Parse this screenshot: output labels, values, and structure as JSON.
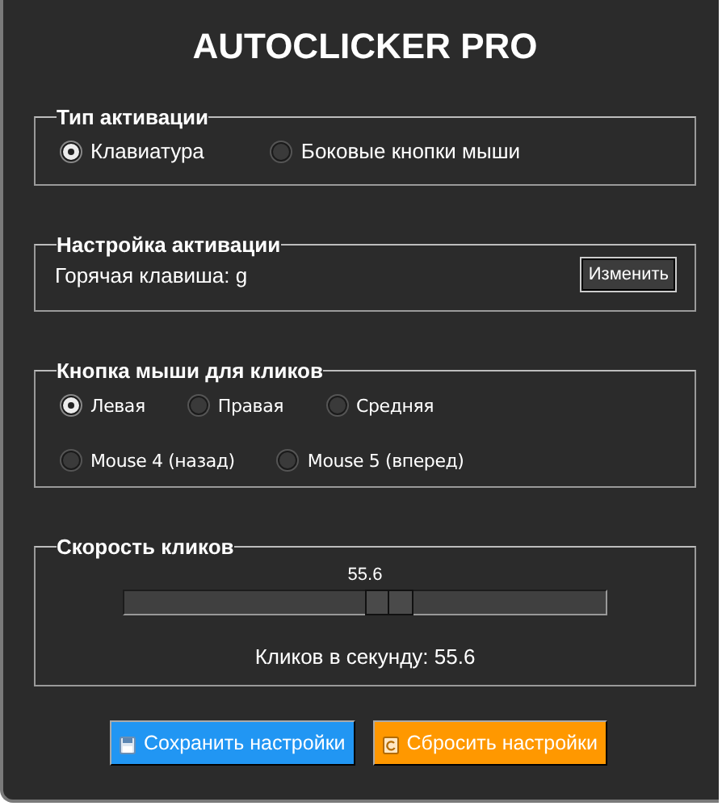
{
  "title": "AUTOCLICKER PRO",
  "activation_type": {
    "legend": "Тип активации",
    "rows": [
      [
        {
          "label": "Клавиатура",
          "selected": true
        },
        {
          "label": "Боковые кнопки мыши",
          "selected": false
        }
      ]
    ]
  },
  "activation_settings": {
    "legend": "Настройка активации",
    "hotkey_label": "Горячая клавиша: g",
    "change_button": "Изменить"
  },
  "mouse_button": {
    "legend": "Кнопка мыши для кликов",
    "options": [
      {
        "label": "Левая",
        "selected": true
      },
      {
        "label": "Правая",
        "selected": false
      },
      {
        "label": "Средняя",
        "selected": false
      },
      {
        "label": "Mouse 4 (назад)",
        "selected": false
      },
      {
        "label": "Mouse 5 (вперед)",
        "selected": false
      }
    ]
  },
  "click_speed": {
    "legend": "Скорость кликов",
    "value": "55.6",
    "level": 0.55,
    "reading": "Кликов в секунду: 55.6"
  },
  "buttons": [
    {
      "kind": "save",
      "label": "Сохранить настройки"
    },
    {
      "kind": "reset",
      "label": "Сбросить настройки"
    }
  ]
}
